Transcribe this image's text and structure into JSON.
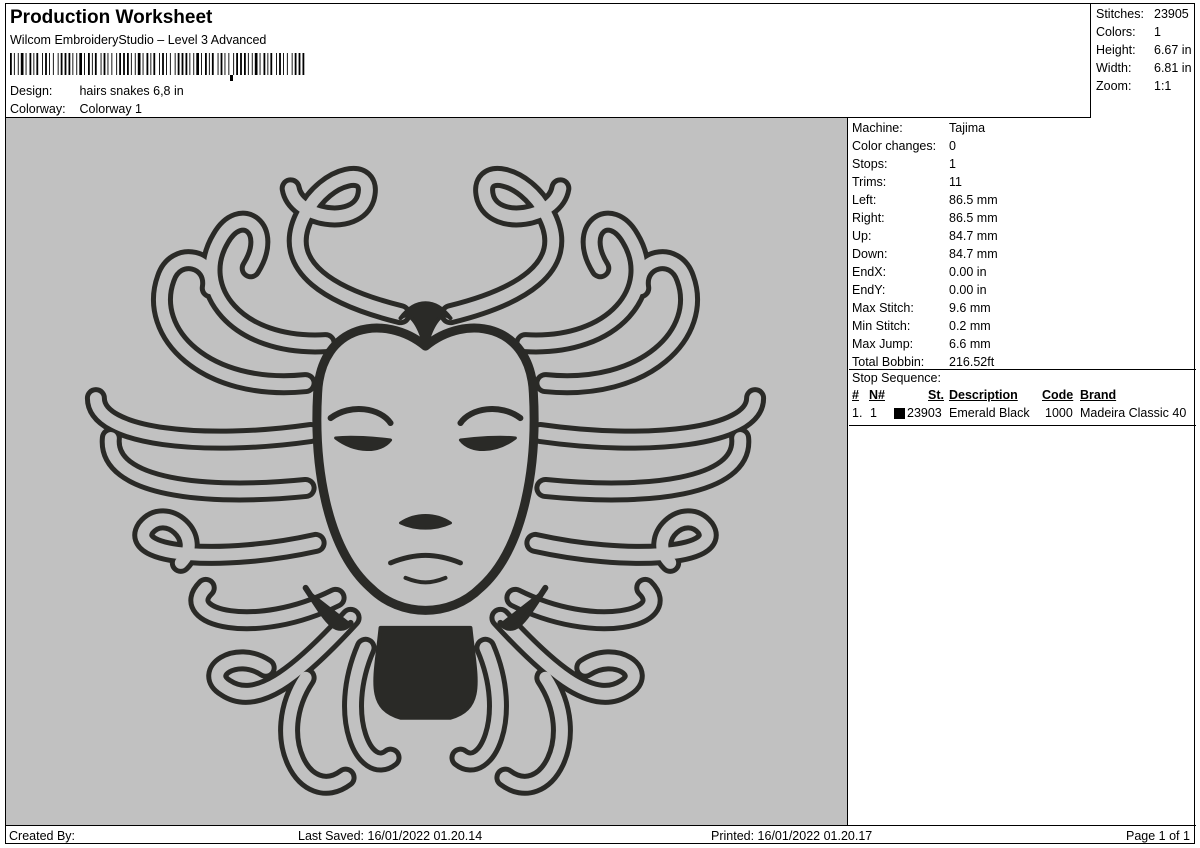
{
  "header": {
    "title": "Production Worksheet",
    "software": "Wilcom EmbroideryStudio – Level 3 Advanced",
    "design_label": "Design:",
    "design_value": "hairs snakes 6,8 in",
    "colorway_label": "Colorway:",
    "colorway_value": "Colorway 1"
  },
  "summary": {
    "stitches_label": "Stitches:",
    "stitches_value": "23905",
    "colors_label": "Colors:",
    "colors_value": "1",
    "height_label": "Height:",
    "height_value": "6.67 in",
    "width_label": "Width:",
    "width_value": "6.81 in",
    "zoom_label": "Zoom:",
    "zoom_value": "1:1"
  },
  "machine_info": [
    {
      "label": "Machine:",
      "value": "Tajima"
    },
    {
      "label": "Color changes:",
      "value": "0"
    },
    {
      "label": "Stops:",
      "value": "1"
    },
    {
      "label": "Trims:",
      "value": "11"
    },
    {
      "label": "Left:",
      "value": "86.5 mm"
    },
    {
      "label": "Right:",
      "value": "86.5 mm"
    },
    {
      "label": "Up:",
      "value": "84.7 mm"
    },
    {
      "label": "Down:",
      "value": "84.7 mm"
    },
    {
      "label": "EndX:",
      "value": "0.00 in"
    },
    {
      "label": "EndY:",
      "value": "0.00 in"
    },
    {
      "label": "Max Stitch:",
      "value": "9.6 mm"
    },
    {
      "label": "Min Stitch:",
      "value": "0.2 mm"
    },
    {
      "label": "Max Jump:",
      "value": "6.6 mm"
    },
    {
      "label": "Total Bobbin:",
      "value": "216.52ft"
    }
  ],
  "stop_sequence": {
    "title": "Stop Sequence:",
    "headers": {
      "num": "#",
      "n": "N#",
      "st": "St.",
      "description": "Description",
      "code": "Code",
      "brand": "Brand"
    },
    "rows": [
      {
        "num": "1.",
        "n": "1",
        "swatch_color": "#000000",
        "st": "23903",
        "description": "Emerald Black",
        "code": "1000",
        "brand": "Madeira Classic 40"
      }
    ]
  },
  "footer": {
    "created_by": "Created By:",
    "last_saved": "Last Saved: 16/01/2022 01.20.14",
    "printed": "Printed: 16/01/2022 01.20.17",
    "page": "Page 1 of 1"
  },
  "colors": {
    "design_background": "#c1c1c1",
    "thread": "#2a2a27",
    "thread_fill": "#c1c1c1"
  }
}
